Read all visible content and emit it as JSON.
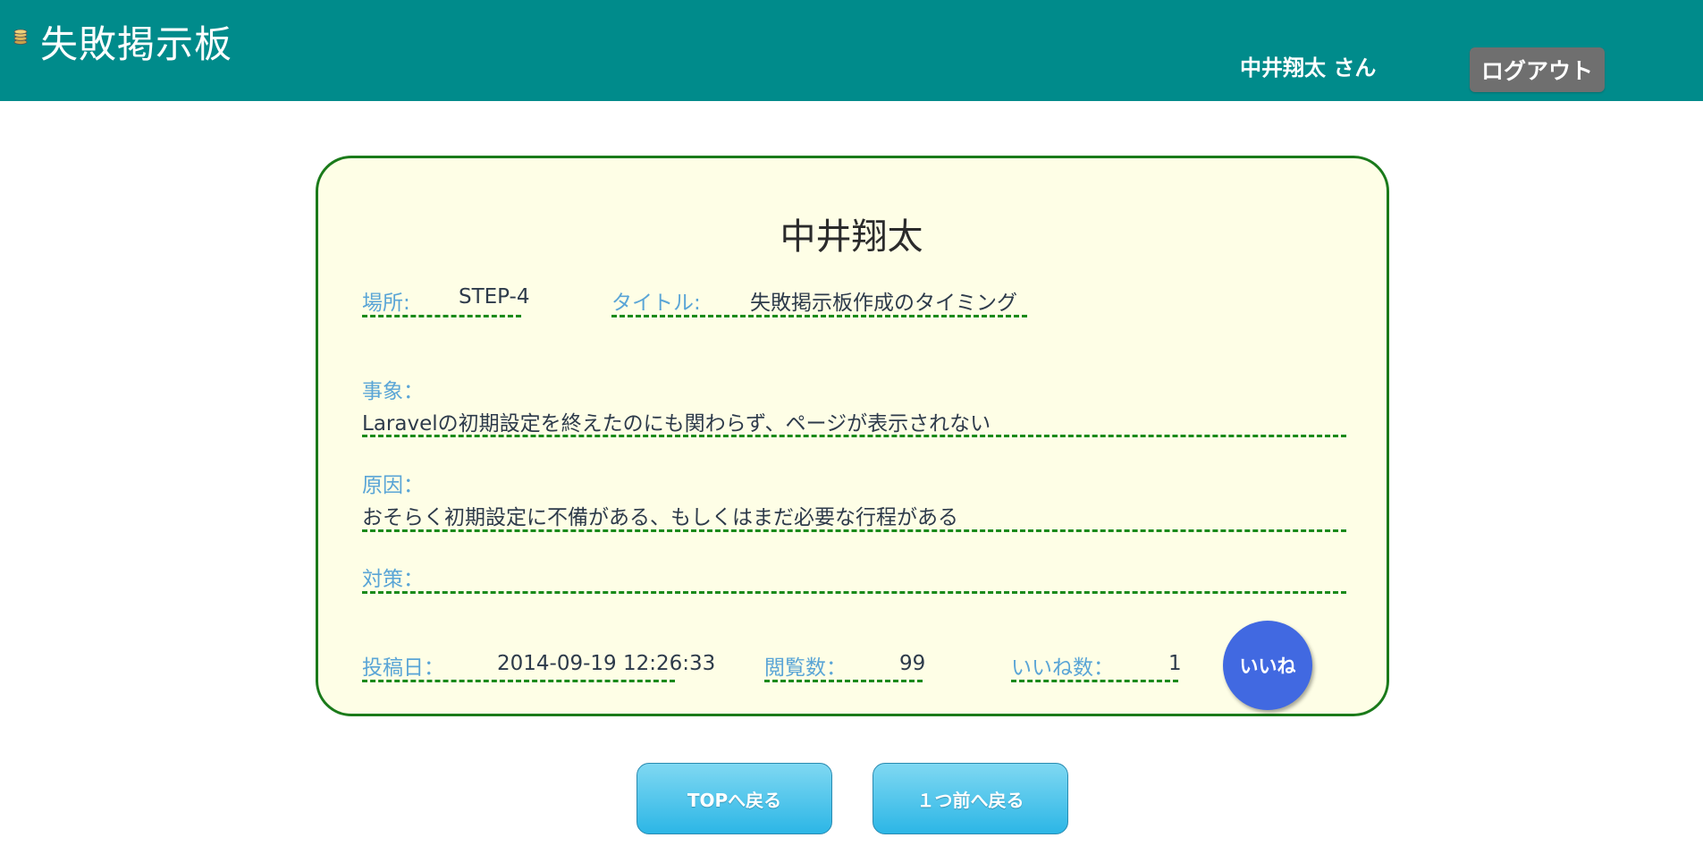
{
  "header": {
    "site_title": "失敗掲示板",
    "user_label": "中井翔太 さん",
    "logout_label": "ログアウト",
    "logo_icon": "coin-stack-icon",
    "bg_color": "#008b8b"
  },
  "post": {
    "author": "中井翔太",
    "place_label": "場所:",
    "place_value": "STEP-4",
    "title_label": "タイトル:",
    "title_value": "失敗掲示板作成のタイミング",
    "event_label": "事象：",
    "event_value": "Laravelの初期設定を終えたのにも関わらず、ページが表示されない",
    "cause_label": "原因：",
    "cause_value": "おそらく初期設定に不備がある、もしくはまだ必要な行程がある",
    "measure_label": "対策：",
    "measure_value": "",
    "posted_label": "投稿日：",
    "posted_value": "2014-09-19 12:26:33",
    "views_label": "閲覧数：",
    "views_value": "99",
    "likes_label": "いいね数：",
    "likes_value": "1",
    "like_button_label": "いいね"
  },
  "nav": {
    "top_label": "TOPへ戻る",
    "back_label": "１つ前へ戻る"
  },
  "colors": {
    "card_border": "#1a7a1a",
    "card_bg": "#fefee6",
    "label_color": "#5aa5d6",
    "like_button": "#4169e1",
    "nav_button": "#2cb6e6"
  }
}
